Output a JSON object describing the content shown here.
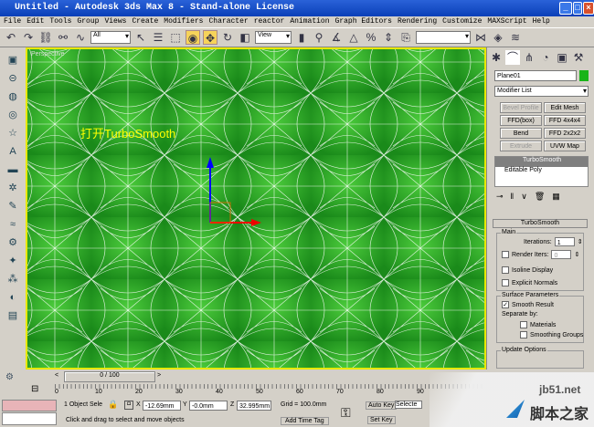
{
  "window": {
    "title": "Untitled - Autodesk 3ds Max 8  - Stand-alone License"
  },
  "menu": [
    "File",
    "Edit",
    "Tools",
    "Group",
    "Views",
    "Create",
    "Modifiers",
    "Character",
    "reactor",
    "Animation",
    "Graph Editors",
    "Rendering",
    "Customize",
    "MAXScript",
    "Help"
  ],
  "toolbar": {
    "selection_filter": "All",
    "ref_coord": "View",
    "named_sel": ""
  },
  "viewport": {
    "label": "Perspective",
    "annotation": "打开TurboSmooth"
  },
  "command_panel": {
    "object_name": "Plane01",
    "object_color": "#19b419",
    "modifier_list": "Modifier List",
    "modifier_buttons": [
      {
        "label": "Bevel Profile",
        "disabled": true
      },
      {
        "label": "Edit Mesh"
      },
      {
        "label": "FFD(box)"
      },
      {
        "label": "FFD 4x4x4"
      },
      {
        "label": "Bend"
      },
      {
        "label": "FFD 2x2x2"
      },
      {
        "label": "Extrude",
        "disabled": true
      },
      {
        "label": "UVW Map"
      }
    ],
    "stack": [
      "TurboSmooth",
      "Editable Poly"
    ],
    "rollout": {
      "title": "TurboSmooth",
      "main": "Main",
      "iterations_label": "Iterations:",
      "iterations": "1",
      "render_iters_label": "Render Iters:",
      "render_iters": "0",
      "isoline": "Isoline Display",
      "explicit": "Explicit Normals",
      "surface": "Surface Parameters",
      "smooth_result": "Smooth Result",
      "separate_by": "Separate by:",
      "materials": "Materials",
      "smoothing_groups": "Smoothing Groups",
      "update": "Update Options"
    }
  },
  "timeline": {
    "frame": "0 / 100",
    "ticks": [
      "0",
      "10",
      "20",
      "30",
      "40",
      "50",
      "60",
      "70",
      "80",
      "90"
    ]
  },
  "status": {
    "selection": "1 Object Sele",
    "x": "-12.69mm",
    "y": "-0.0mm",
    "z": "32.995mm",
    "grid": "Grid = 100.0mm",
    "prompt": "Click and drag to select and move objects",
    "add_time_tag": "Add Time Tag",
    "auto_key": "Auto Key",
    "set_key": "Set Key",
    "key_filter": "Selecte"
  },
  "watermark": {
    "site": "jb51.net",
    "name": "脚本之家"
  }
}
